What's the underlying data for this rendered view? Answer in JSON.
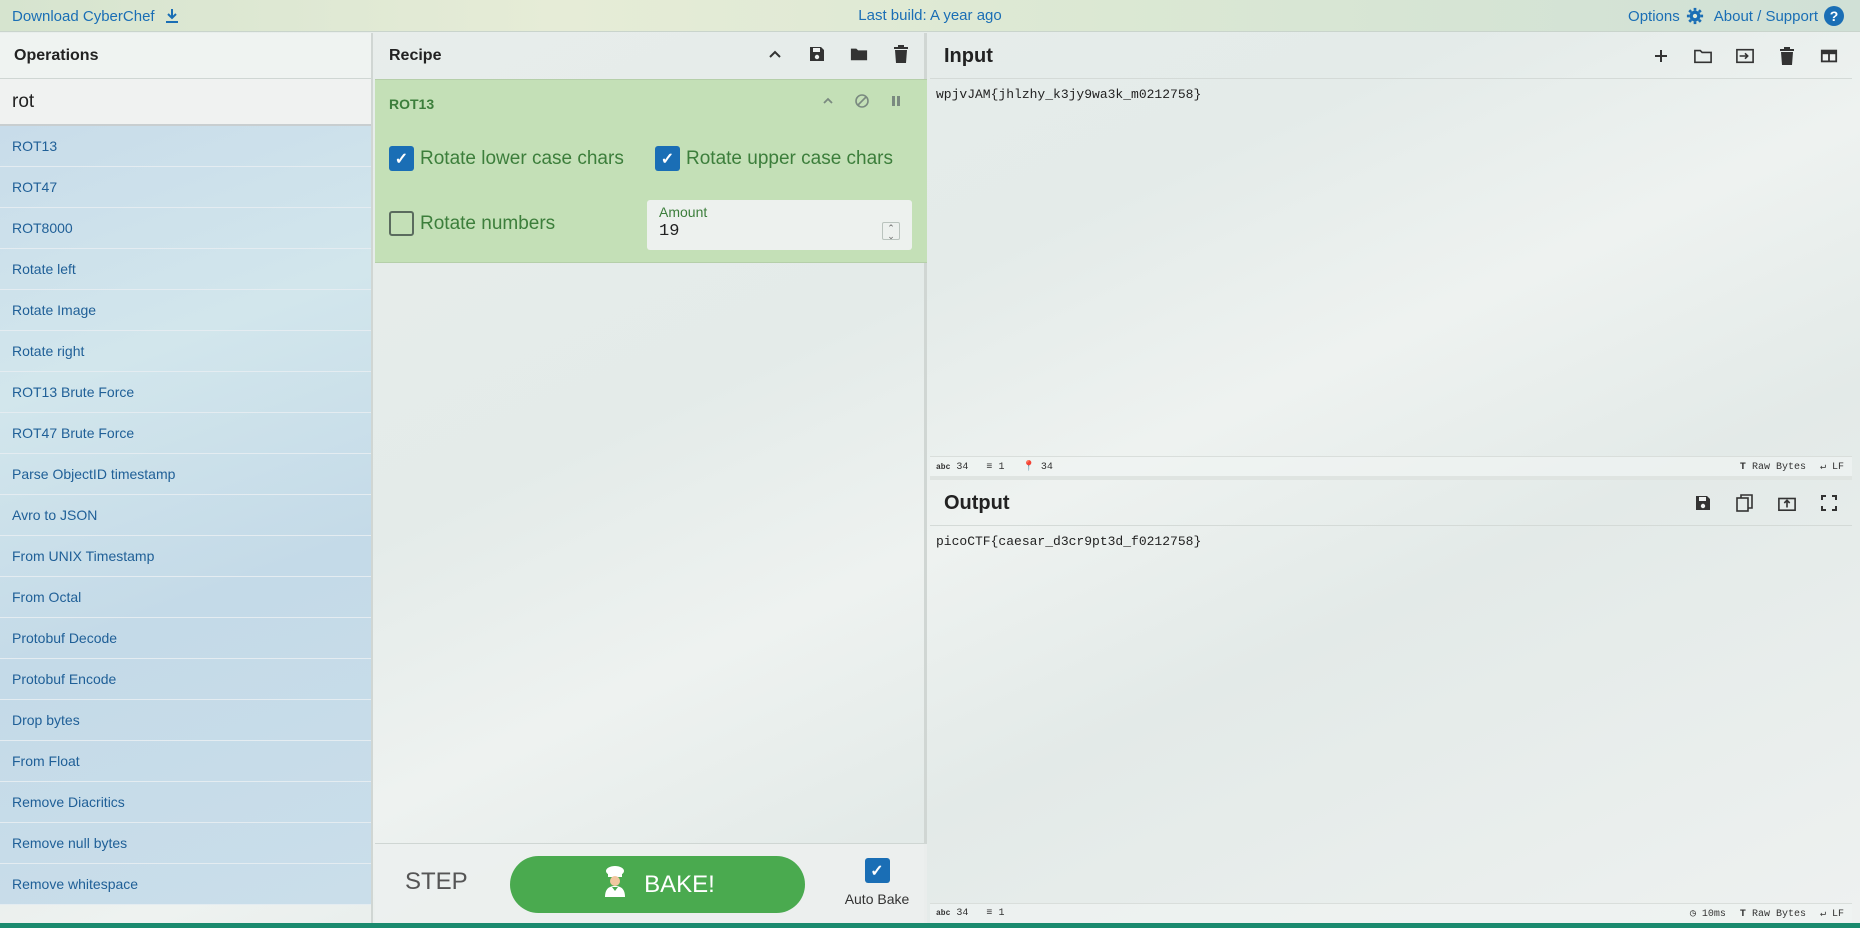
{
  "banner": {
    "download_label": "Download CyberChef",
    "last_build": "Last build: A year ago",
    "options_label": "Options",
    "about_label": "About / Support"
  },
  "operations": {
    "title": "Operations",
    "search_value": "rot",
    "items": [
      "ROT13",
      "ROT47",
      "ROT8000",
      "Rotate left",
      "Rotate Image",
      "Rotate right",
      "ROT13 Brute Force",
      "ROT47 Brute Force",
      "Parse ObjectID timestamp",
      "Avro to JSON",
      "From UNIX Timestamp",
      "From Octal",
      "Protobuf Decode",
      "Protobuf Encode",
      "Drop bytes",
      "From Float",
      "Remove Diacritics",
      "Remove null bytes",
      "Remove whitespace"
    ]
  },
  "recipe": {
    "title": "Recipe",
    "operation": {
      "name": "ROT13",
      "rotate_lower_label": "Rotate lower case chars",
      "rotate_lower_checked": true,
      "rotate_upper_label": "Rotate upper case chars",
      "rotate_upper_checked": true,
      "rotate_numbers_label": "Rotate numbers",
      "rotate_numbers_checked": false,
      "amount_label": "Amount",
      "amount_value": "19"
    },
    "step_label": "STEP",
    "bake_label": "BAKE!",
    "auto_bake_label": "Auto Bake",
    "auto_bake_checked": true
  },
  "input": {
    "title": "Input",
    "text": "wpjvJAM{jhlzhy_k3jy9wa3k_m0212758}",
    "status": {
      "length": "34",
      "lines": "1",
      "position": "34",
      "encoding": "Raw Bytes",
      "eol": "LF"
    }
  },
  "output": {
    "title": "Output",
    "text": "picoCTF{caesar_d3cr9pt3d_f0212758}",
    "status": {
      "length": "34",
      "lines": "1",
      "time": "10ms",
      "encoding": "Raw Bytes",
      "eol": "LF"
    }
  },
  "colors": {
    "accent_blue": "#1a6eb5",
    "recipe_green": "#3c7e3b",
    "bake_green": "#4aaa4f",
    "op_bg_green": "#c4e0b7"
  }
}
